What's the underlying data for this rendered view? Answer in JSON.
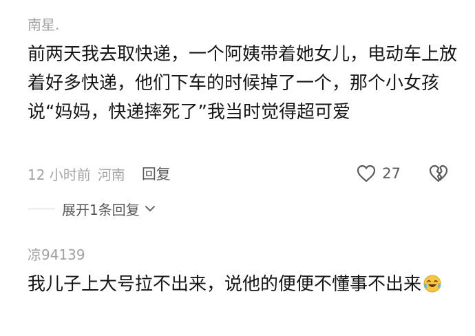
{
  "comments": [
    {
      "username": "南星.",
      "text": "前两天我去取快递，一个阿姨带着她女儿，电动车上放着好多快递，他们下车的时候掉了一个，那个小女孩说“妈妈，快递摔死了”我当时觉得超可爱",
      "meta": {
        "time": "12 小时前",
        "location": "河南",
        "reply_label": "回复",
        "like_count": "27"
      },
      "expand_label": "展开1条回复"
    },
    {
      "username": "凉94139",
      "text": "我儿子上大号拉不出来，说他的便便不懂事不出来",
      "emoji": "crying-laughing-emoji"
    }
  ],
  "colors": {
    "username": "#a0a0a0",
    "text": "#161616",
    "meta": "#a3a3a3",
    "action": "#5a5a5a"
  }
}
